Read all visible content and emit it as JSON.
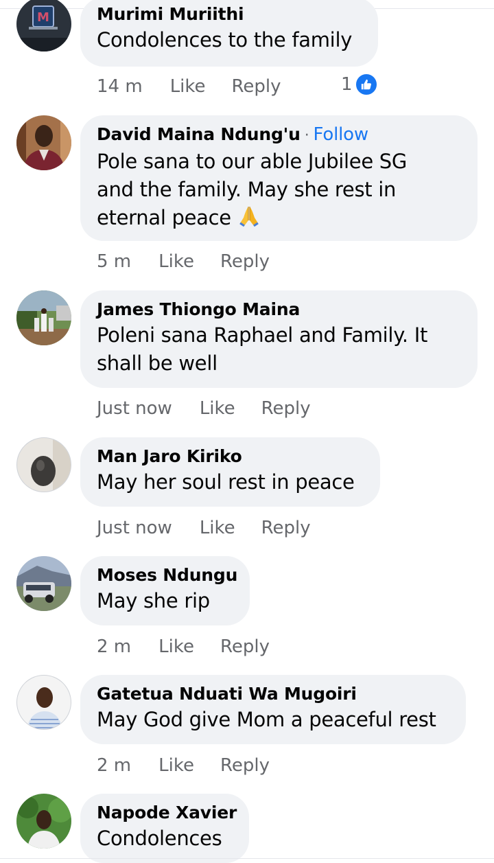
{
  "comments": [
    {
      "name": "Murimi Muriithi",
      "text": "Condolences to the family",
      "time": "14 m",
      "like_label": "Like",
      "reply_label": "Reply",
      "reaction_count": "1",
      "reaction_icon": "thumbs-up-icon"
    },
    {
      "name": "David Maina Ndung'u",
      "separator": "·",
      "follow_label": "Follow",
      "text_line1": "Pole sana to our able Jubilee SG",
      "text_line2": "and the family. May she rest in",
      "text_line3": "eternal peace",
      "emoji": "folded-hands-emoji",
      "time": "5 m",
      "like_label": "Like",
      "reply_label": "Reply"
    },
    {
      "name": "James Thiongo Maina",
      "text_line1": "Poleni sana Raphael and Family. It",
      "text_line2": "shall be well",
      "time": "Just now",
      "like_label": "Like",
      "reply_label": "Reply"
    },
    {
      "name": "Man Jaro Kiriko",
      "text": "May her soul rest in peace",
      "time": "Just now",
      "like_label": "Like",
      "reply_label": "Reply"
    },
    {
      "name": "Moses Ndungu",
      "text": "May she rip",
      "time": "2 m",
      "like_label": "Like",
      "reply_label": "Reply"
    },
    {
      "name": "Gatetua Nduati Wa Mugoiri",
      "text": "May God give Mom a peaceful rest",
      "time": "2 m",
      "like_label": "Like",
      "reply_label": "Reply"
    },
    {
      "name": "Napode Xavier",
      "text": "Condolences"
    }
  ],
  "colors": {
    "bubble_bg": "#f0f2f5",
    "link_blue": "#1877f2",
    "meta_gray": "#65676b",
    "text": "#050505"
  }
}
